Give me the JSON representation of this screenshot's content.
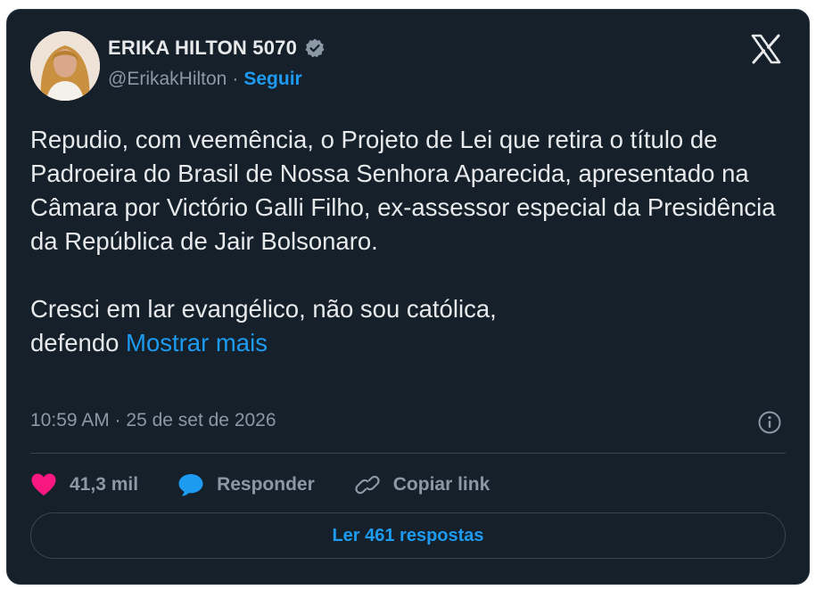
{
  "author": {
    "name": "ERIKA HILTON 5070",
    "handle": "@ErikakHilton",
    "separator": "·",
    "follow_label": "Seguir",
    "avatar_icon": "avatar-photo",
    "verified_icon": "verified-badge-icon"
  },
  "tweet": {
    "paragraph1": "Repudio, com veemência, o Projeto de Lei que retira o título de Padroeira do Brasil de Nossa Senhora Aparecida, apresentado na Câmara por Victório Galli Filho, ex-assessor especial da Presidência da República de Jair Bolsonaro.",
    "paragraph2_line1": "Cresci em lar evangélico, não sou católica,",
    "paragraph2_line2": "defendo",
    "show_more": "Mostrar mais"
  },
  "timestamp": "10:59 AM · 25 de set de 2026",
  "actions": {
    "likes": "41,3 mil",
    "reply_label": "Responder",
    "copy_link_label": "Copiar link"
  },
  "replies_button": "Ler 461 respostas",
  "colors": {
    "background": "#15202b",
    "text": "#e7e9ea",
    "muted": "#8b98a5",
    "accent": "#1d9bf0",
    "like": "#f91880"
  }
}
